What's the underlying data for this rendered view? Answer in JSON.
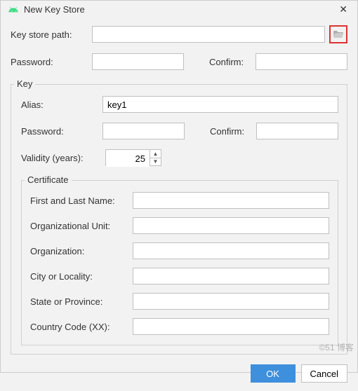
{
  "window": {
    "title": "New Key Store",
    "close_glyph": "✕"
  },
  "keystore": {
    "path_label": "Key store path:",
    "path_value": "",
    "password_label": "Password:",
    "password_value": "",
    "confirm_label": "Confirm:",
    "confirm_value": ""
  },
  "key": {
    "legend": "Key",
    "alias_label": "Alias:",
    "alias_value": "key1",
    "password_label": "Password:",
    "password_value": "",
    "confirm_label": "Confirm:",
    "confirm_value": "",
    "validity_label": "Validity (years):",
    "validity_value": "25"
  },
  "certificate": {
    "legend": "Certificate",
    "fields": {
      "first_last": {
        "label": "First and Last Name:",
        "value": ""
      },
      "org_unit": {
        "label": "Organizational Unit:",
        "value": ""
      },
      "org": {
        "label": "Organization:",
        "value": ""
      },
      "city": {
        "label": "City or Locality:",
        "value": ""
      },
      "state": {
        "label": "State or Province:",
        "value": ""
      },
      "country": {
        "label": "Country Code (XX):",
        "value": ""
      }
    }
  },
  "buttons": {
    "ok": "OK",
    "cancel": "Cancel"
  },
  "icons": {
    "browse": "folder-open-icon",
    "app": "android-icon"
  },
  "colors": {
    "primary": "#3e8fdc",
    "focus_border": "#7bb1e8",
    "highlight_border": "#d33"
  },
  "watermark": "©51 博客"
}
